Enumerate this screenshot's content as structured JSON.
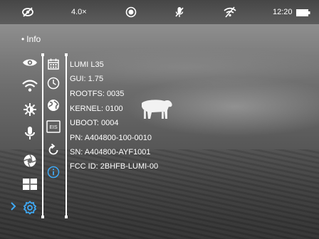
{
  "status_bar": {
    "icons": [
      "camera-off-icon",
      "record-icon",
      "mic-off-icon",
      "wifi-off-icon",
      "battery-icon"
    ],
    "zoom": "4.0×",
    "time": "12:20"
  },
  "menu": {
    "title": "Info",
    "side_items": [
      "eye-icon",
      "wifi-icon",
      "brightness-icon",
      "microphone-icon",
      "shutter-icon",
      "grid-icon",
      "settings-icon"
    ],
    "selected_item": "settings-icon",
    "sub_icons": [
      "calendar-icon",
      "clock-icon",
      "globe-icon",
      "eis-icon",
      "reset-icon",
      "info-icon"
    ],
    "eis_label": "EIS"
  },
  "info": {
    "lines": [
      "LUMI L35",
      "GUI: 1.75",
      "ROOTFS: 0035",
      "KERNEL: 0100",
      "UBOOT: 0004",
      "PN: A404800-100-0010",
      "SN: A404800-AYF1001",
      "FCC ID: 2BHFB-LUMI-00"
    ]
  },
  "colors": {
    "accent": "#3fa9f5",
    "text": "#ffffff"
  }
}
